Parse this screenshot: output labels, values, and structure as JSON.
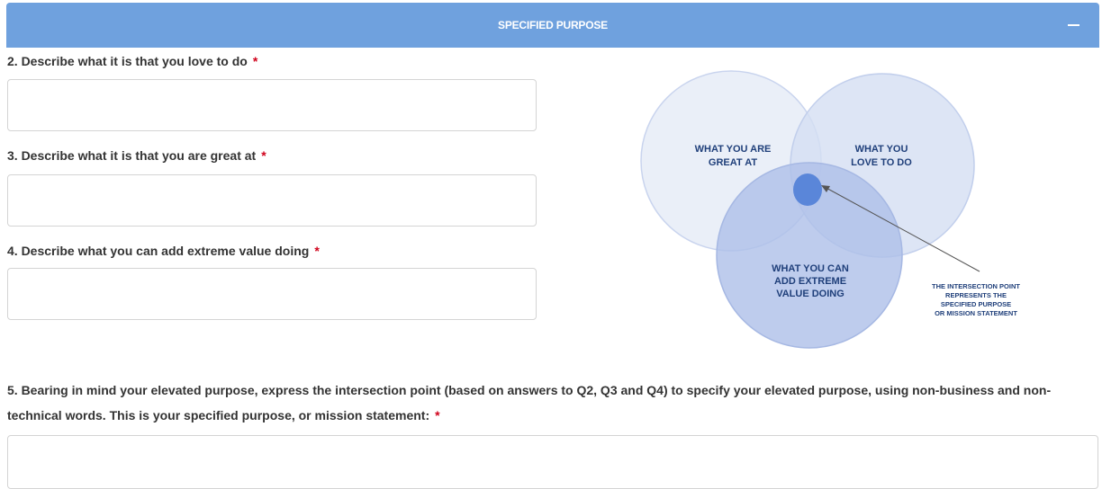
{
  "section": {
    "title": "SPECIFIED PURPOSE",
    "collapse_icon": "minus-icon"
  },
  "questions": [
    {
      "label": "2. Describe what it is that you love to do",
      "required_mark": "*"
    },
    {
      "label": "3. Describe what it is that you are great at",
      "required_mark": "*"
    },
    {
      "label": "4. Describe what you can add extreme value doing",
      "required_mark": "*"
    },
    {
      "label": "5. Bearing in mind your elevated purpose, express the intersection point (based on answers to Q2, Q3 and Q4) to specify your elevated purpose, using non-business and non-technical words. This is your specified purpose, or mission statement:",
      "required_mark": "*"
    }
  ],
  "diagram": {
    "great_at": [
      "WHAT YOU ARE",
      "GREAT AT"
    ],
    "love_to_do": [
      "WHAT YOU",
      "LOVE TO DO"
    ],
    "extreme_value": [
      "WHAT YOU CAN",
      "ADD EXTREME",
      "VALUE DOING"
    ],
    "intersection_note": [
      "THE INTERSECTION POINT",
      "REPRESENTS THE",
      "SPECIFIED PURPOSE",
      "OR MISSION STATEMENT"
    ],
    "colors": {
      "circle_fill": "#dfe6f5",
      "circle_stroke": "#c7d3ee",
      "dot": "#5a86d9",
      "text": "#1f3f7a"
    }
  }
}
